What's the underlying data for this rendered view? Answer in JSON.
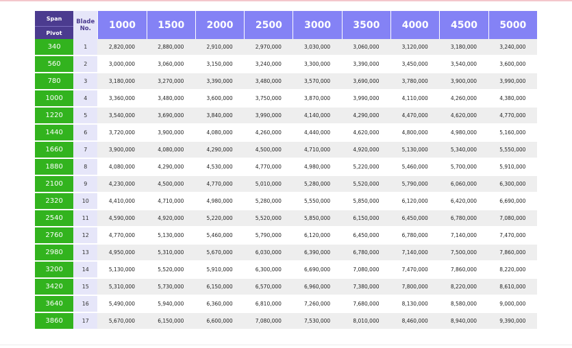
{
  "header": {
    "span_label": "Span",
    "pivot_label": "Pivot",
    "blade_label": "Blade No.",
    "span_values": [
      "1000",
      "1500",
      "2000",
      "2500",
      "3000",
      "3500",
      "4000",
      "4500",
      "5000"
    ]
  },
  "rows": [
    {
      "pivot": "340",
      "blade": "1",
      "prices": [
        "2,820,000",
        "2,880,000",
        "2,910,000",
        "2,970,000",
        "3,030,000",
        "3,060,000",
        "3,120,000",
        "3,180,000",
        "3,240,000"
      ]
    },
    {
      "pivot": "560",
      "blade": "2",
      "prices": [
        "3,000,000",
        "3,060,000",
        "3,150,000",
        "3,240,000",
        "3,300,000",
        "3,390,000",
        "3,450,000",
        "3,540,000",
        "3,600,000"
      ]
    },
    {
      "pivot": "780",
      "blade": "3",
      "prices": [
        "3,180,000",
        "3,270,000",
        "3,390,000",
        "3,480,000",
        "3,570,000",
        "3,690,000",
        "3,780,000",
        "3,900,000",
        "3,990,000"
      ]
    },
    {
      "pivot": "1000",
      "blade": "4",
      "prices": [
        "3,360,000",
        "3,480,000",
        "3,600,000",
        "3,750,000",
        "3,870,000",
        "3,990,000",
        "4,110,000",
        "4,260,000",
        "4,380,000"
      ]
    },
    {
      "pivot": "1220",
      "blade": "5",
      "prices": [
        "3,540,000",
        "3,690,000",
        "3,840,000",
        "3,990,000",
        "4,140,000",
        "4,290,000",
        "4,470,000",
        "4,620,000",
        "4,770,000"
      ]
    },
    {
      "pivot": "1440",
      "blade": "6",
      "prices": [
        "3,720,000",
        "3,900,000",
        "4,080,000",
        "4,260,000",
        "4,440,000",
        "4,620,000",
        "4,800,000",
        "4,980,000",
        "5,160,000"
      ]
    },
    {
      "pivot": "1660",
      "blade": "7",
      "prices": [
        "3,900,000",
        "4,080,000",
        "4,290,000",
        "4,500,000",
        "4,710,000",
        "4,920,000",
        "5,130,000",
        "5,340,000",
        "5,550,000"
      ]
    },
    {
      "pivot": "1880",
      "blade": "8",
      "prices": [
        "4,080,000",
        "4,290,000",
        "4,530,000",
        "4,770,000",
        "4,980,000",
        "5,220,000",
        "5,460,000",
        "5,700,000",
        "5,910,000"
      ]
    },
    {
      "pivot": "2100",
      "blade": "9",
      "prices": [
        "4,230,000",
        "4,500,000",
        "4,770,000",
        "5,010,000",
        "5,280,000",
        "5,520,000",
        "5,790,000",
        "6,060,000",
        "6,300,000"
      ]
    },
    {
      "pivot": "2320",
      "blade": "10",
      "prices": [
        "4,410,000",
        "4,710,000",
        "4,980,000",
        "5,280,000",
        "5,550,000",
        "5,850,000",
        "6,120,000",
        "6,420,000",
        "6,690,000"
      ]
    },
    {
      "pivot": "2540",
      "blade": "11",
      "prices": [
        "4,590,000",
        "4,920,000",
        "5,220,000",
        "5,520,000",
        "5,850,000",
        "6,150,000",
        "6,450,000",
        "6,780,000",
        "7,080,000"
      ]
    },
    {
      "pivot": "2760",
      "blade": "12",
      "prices": [
        "4,770,000",
        "5,130,000",
        "5,460,000",
        "5,790,000",
        "6,120,000",
        "6,450,000",
        "6,780,000",
        "7,140,000",
        "7,470,000"
      ]
    },
    {
      "pivot": "2980",
      "blade": "13",
      "prices": [
        "4,950,000",
        "5,310,000",
        "5,670,000",
        "6,030,000",
        "6,390,000",
        "6,780,000",
        "7,140,000",
        "7,500,000",
        "7,860,000"
      ]
    },
    {
      "pivot": "3200",
      "blade": "14",
      "prices": [
        "5,130,000",
        "5,520,000",
        "5,910,000",
        "6,300,000",
        "6,690,000",
        "7,080,000",
        "7,470,000",
        "7,860,000",
        "8,220,000"
      ]
    },
    {
      "pivot": "3420",
      "blade": "15",
      "prices": [
        "5,310,000",
        "5,730,000",
        "6,150,000",
        "6,570,000",
        "6,960,000",
        "7,380,000",
        "7,800,000",
        "8,220,000",
        "8,610,000"
      ]
    },
    {
      "pivot": "3640",
      "blade": "16",
      "prices": [
        "5,490,000",
        "5,940,000",
        "6,360,000",
        "6,810,000",
        "7,260,000",
        "7,680,000",
        "8,130,000",
        "8,580,000",
        "9,000,000"
      ]
    },
    {
      "pivot": "3860",
      "blade": "17",
      "prices": [
        "5,670,000",
        "6,150,000",
        "6,600,000",
        "7,080,000",
        "7,530,000",
        "8,010,000",
        "8,460,000",
        "8,940,000",
        "9,390,000"
      ]
    }
  ],
  "colors": {
    "header_purple": "#4b3b8f",
    "header_blue": "#8482f5",
    "pivot_green": "#32b31e",
    "blade_lavender": "#e6e6f9",
    "row_stripe": "#eeeeee"
  }
}
